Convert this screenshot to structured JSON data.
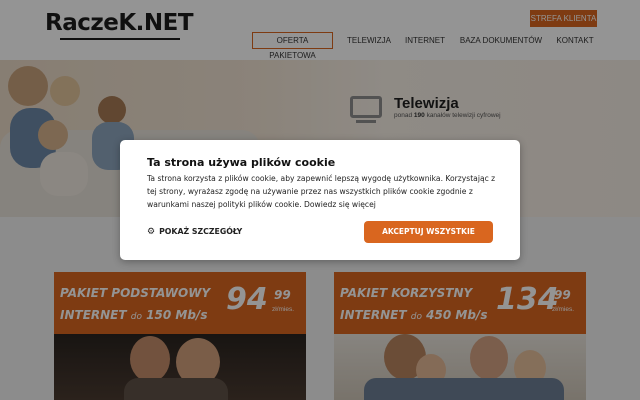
{
  "brand": {
    "logo_text": "RaczeK.NET"
  },
  "header": {
    "strefa_label": "STREFA KLIENTA",
    "nav": [
      "OFERTA PAKIETOWA",
      "TELEWIZJA",
      "INTERNET",
      "BAZA DOKUMENTÓW",
      "KONTAKT"
    ]
  },
  "hero": {
    "title": "Telewizja",
    "sub_prefix": "ponad",
    "sub_count": "190",
    "sub_suffix": "kanałów telewizji cyfrowej"
  },
  "cards": [
    {
      "name": "PAKIET PODSTAWOWY",
      "speed_prefix": "INTERNET",
      "speed_do": "do",
      "speed": "150 Mb/s",
      "price": "94",
      "cents": "99",
      "unit": "zł/mies."
    },
    {
      "name": "PAKIET KORZYSTNY",
      "speed_prefix": "INTERNET",
      "speed_do": "do",
      "speed": "450 Mb/s",
      "price": "134",
      "cents": "99",
      "unit": "zł/mies."
    }
  ],
  "cookie": {
    "title": "Ta strona używa plików cookie",
    "line1": "Ta strona korzysta z plików cookie, aby zapewnić lepszą wygodę użytkownika. Korzystając z",
    "line2": "tej strony, wyrażasz zgodę na używanie przez nas wszystkich plików cookie zgodnie z",
    "line3": "warunkami naszej polityki plików cookie. Dowiedz się więcej",
    "details_label": "POKAŻ SZCZEGÓŁY",
    "accept_label": "AKCEPTUJ WSZYSTKIE"
  },
  "icons": [
    "tv-icon",
    "gear-icon"
  ],
  "colors": {
    "accent": "#d9661f"
  }
}
